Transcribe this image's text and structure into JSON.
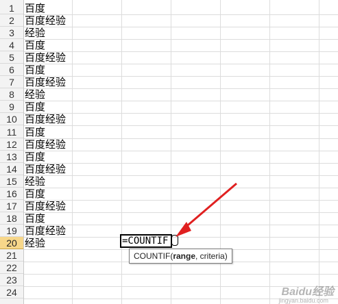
{
  "sheet": {
    "rows": [
      {
        "num": "1",
        "value": "百度"
      },
      {
        "num": "2",
        "value": "百度经验"
      },
      {
        "num": "3",
        "value": "经验"
      },
      {
        "num": "4",
        "value": "百度"
      },
      {
        "num": "5",
        "value": "百度经验"
      },
      {
        "num": "6",
        "value": "百度"
      },
      {
        "num": "7",
        "value": "百度经验"
      },
      {
        "num": "8",
        "value": "经验"
      },
      {
        "num": "9",
        "value": "百度"
      },
      {
        "num": "10",
        "value": "百度经验"
      },
      {
        "num": "11",
        "value": "百度"
      },
      {
        "num": "12",
        "value": "百度经验"
      },
      {
        "num": "13",
        "value": "百度"
      },
      {
        "num": "14",
        "value": "百度经验"
      },
      {
        "num": "15",
        "value": "经验"
      },
      {
        "num": "16",
        "value": "百度"
      },
      {
        "num": "17",
        "value": "百度经验"
      },
      {
        "num": "18",
        "value": "百度"
      },
      {
        "num": "19",
        "value": "百度经验"
      },
      {
        "num": "20",
        "value": "经验"
      },
      {
        "num": "21",
        "value": ""
      },
      {
        "num": "22",
        "value": ""
      },
      {
        "num": "23",
        "value": ""
      },
      {
        "num": "24",
        "value": ""
      }
    ],
    "active_row": "20",
    "editing_formula": "=COUNTIF",
    "tooltip": {
      "fn": "COUNTIF(",
      "arg1": "range",
      "rest": ", criteria)"
    }
  },
  "colors": {
    "active_row_header": "#f7d78a",
    "arrow": "#e02020"
  },
  "watermark": {
    "text": "Baidu经验",
    "sub": "jingyan.baidu.com"
  }
}
